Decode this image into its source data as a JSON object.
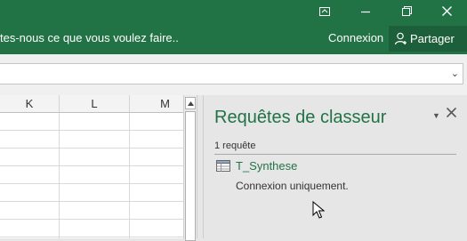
{
  "titlebar": {
    "icons": [
      "ribbon-display-options-icon",
      "minimize-icon",
      "restore-icon",
      "close-icon"
    ],
    "background": "#217346"
  },
  "ribbon": {
    "tell_me": "tes-nous ce que vous voulez faire..",
    "signin": "Connexion",
    "share": "Partager"
  },
  "grid": {
    "columns": [
      "K",
      "L",
      "M"
    ]
  },
  "pane": {
    "title": "Requêtes de classeur",
    "count": "1 requête",
    "query_name": "T_Synthese",
    "query_status": "Connexion uniquement.",
    "accent": "#217346"
  }
}
